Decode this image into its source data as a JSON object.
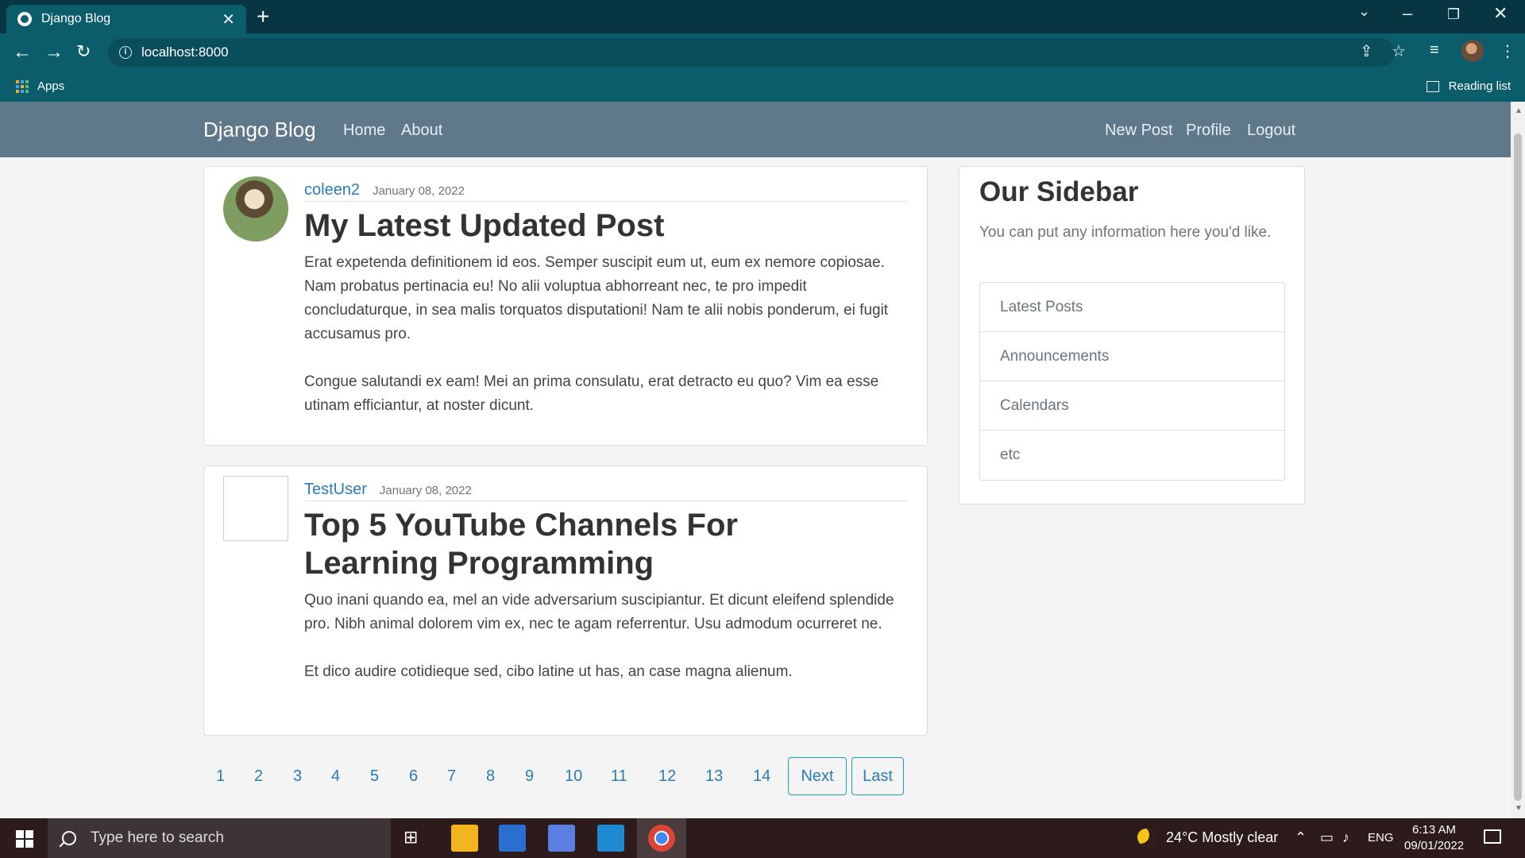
{
  "browser": {
    "tab_title": "Django Blog",
    "url": "localhost:8000",
    "bookmarks_apps": "Apps",
    "reading_list": "Reading list"
  },
  "site": {
    "brand": "Django Blog",
    "nav_left": [
      "Home",
      "About"
    ],
    "nav_right": [
      "New Post",
      "Profile",
      "Logout"
    ]
  },
  "posts": [
    {
      "author": "coleen2",
      "date": "January 08, 2022",
      "title": "My Latest Updated Post",
      "paragraphs": [
        "Erat expetenda definitionem id eos. Semper suscipit eum ut, eum ex nemore copiosae. Nam probatus pertinacia eu! No alii voluptua abhorreant nec, te pro impedit concludaturque, in sea malis torquatos disputationi! Nam te alii nobis ponderum, ei fugit accusamus pro.",
        "Congue salutandi ex eam! Mei an prima consulatu, erat detracto eu quo? Vim ea esse utinam efficiantur, at noster dicunt."
      ]
    },
    {
      "author": "TestUser",
      "date": "January 08, 2022",
      "title": "Top 5 YouTube Channels For Learning Programming",
      "paragraphs": [
        "Quo inani quando ea, mel an vide adversarium suscipiantur. Et dicunt eleifend splendide pro. Nibh animal dolorem vim ex, nec te agam referrentur. Usu admodum ocurreret ne.",
        "Et dico audire cotidieque sed, cibo latine ut has, an case magna alienum."
      ]
    }
  ],
  "sidebar": {
    "title": "Our Sidebar",
    "text": "You can put any information here you'd like.",
    "items": [
      "Latest Posts",
      "Announcements",
      "Calendars",
      "etc"
    ]
  },
  "pagination": {
    "pages": [
      "1",
      "2",
      "3",
      "4",
      "5",
      "6",
      "7",
      "8",
      "9",
      "10",
      "11",
      "12",
      "13",
      "14"
    ],
    "next": "Next",
    "last": "Last"
  },
  "taskbar": {
    "search_placeholder": "Type here to search",
    "weather": "24°C  Mostly clear",
    "language": "ENG",
    "time": "6:13 AM",
    "date": "09/01/2022"
  },
  "colors": {
    "nav_bg": "#5f788a",
    "link": "#2b7bb9",
    "browser_bg": "#0b5d6b"
  }
}
